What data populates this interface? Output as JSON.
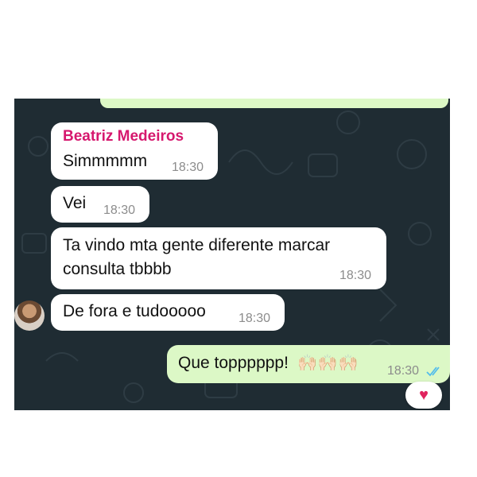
{
  "chat": {
    "messages": [
      {
        "sender": "Beatriz Medeiros",
        "text": "Simmmmm",
        "time": "18:30"
      },
      {
        "text": "Vei",
        "time": "18:30"
      },
      {
        "text_line1": "Ta vindo mta gente diferente marcar",
        "text_line2": "consulta tbbbb",
        "time": "18:30"
      },
      {
        "text": "De fora e tudooooo",
        "time": "18:30"
      },
      {
        "text": "Que topppppp!",
        "emoji": "🙌🏻🙌🏻🙌🏻",
        "time": "18:30"
      }
    ],
    "reaction": "♥",
    "colors": {
      "wallpaper": "#1f2c33",
      "incoming": "#ffffff",
      "outgoing": "#dcf8c6",
      "sender_name": "#d6186e",
      "read_ticks": "#53bdeb"
    }
  }
}
